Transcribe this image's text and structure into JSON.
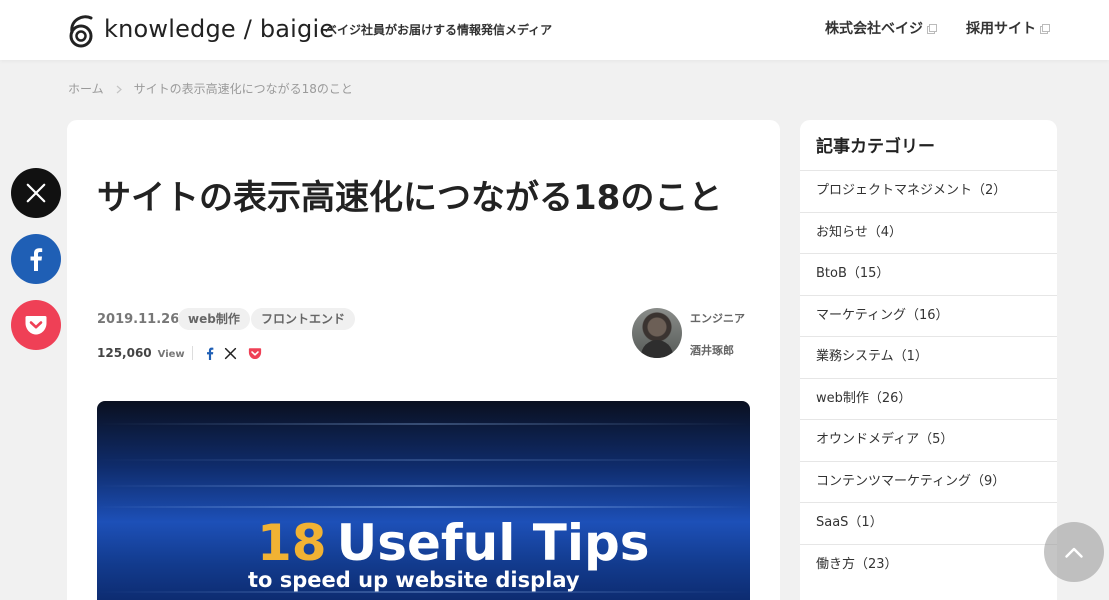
{
  "header": {
    "logo_text": "knowledge / baigie",
    "tagline": "ベイジ社員がお届けする情報発信メディア",
    "links": [
      {
        "label": "株式会社ベイジ"
      },
      {
        "label": "採用サイト"
      }
    ]
  },
  "breadcrumb": {
    "home": "ホーム",
    "current": "サイトの表示高速化につながる18のこと"
  },
  "article": {
    "title": "サイトの表示高速化につながる18のこと",
    "date": "2019.11.26",
    "tags": [
      "web制作",
      "フロントエンド"
    ],
    "views": "125,060",
    "views_suffix": "View",
    "author_role": "エンジニア",
    "author_name": "酒井琢郎",
    "hero": {
      "number": "18",
      "headline": "Useful Tips",
      "subline": "to speed up website display"
    }
  },
  "share": {
    "icons": [
      "x-icon",
      "facebook-icon",
      "pocket-icon"
    ]
  },
  "sidebar": {
    "title": "記事カテゴリー",
    "categories": [
      "プロジェクトマネジメント（2）",
      "お知らせ（4）",
      "BtoB（15）",
      "マーケティング（16）",
      "業務システム（1）",
      "web制作（26）",
      "オウンドメディア（5）",
      "コンテンツマーケティング（9）",
      "SaaS（1）",
      "働き方（23）"
    ]
  },
  "colors": {
    "background": "#f1f1f1",
    "facebook": "#1f5fb5",
    "pocket": "#ef4056",
    "x": "#111111",
    "hero_number": "#f1b233"
  }
}
